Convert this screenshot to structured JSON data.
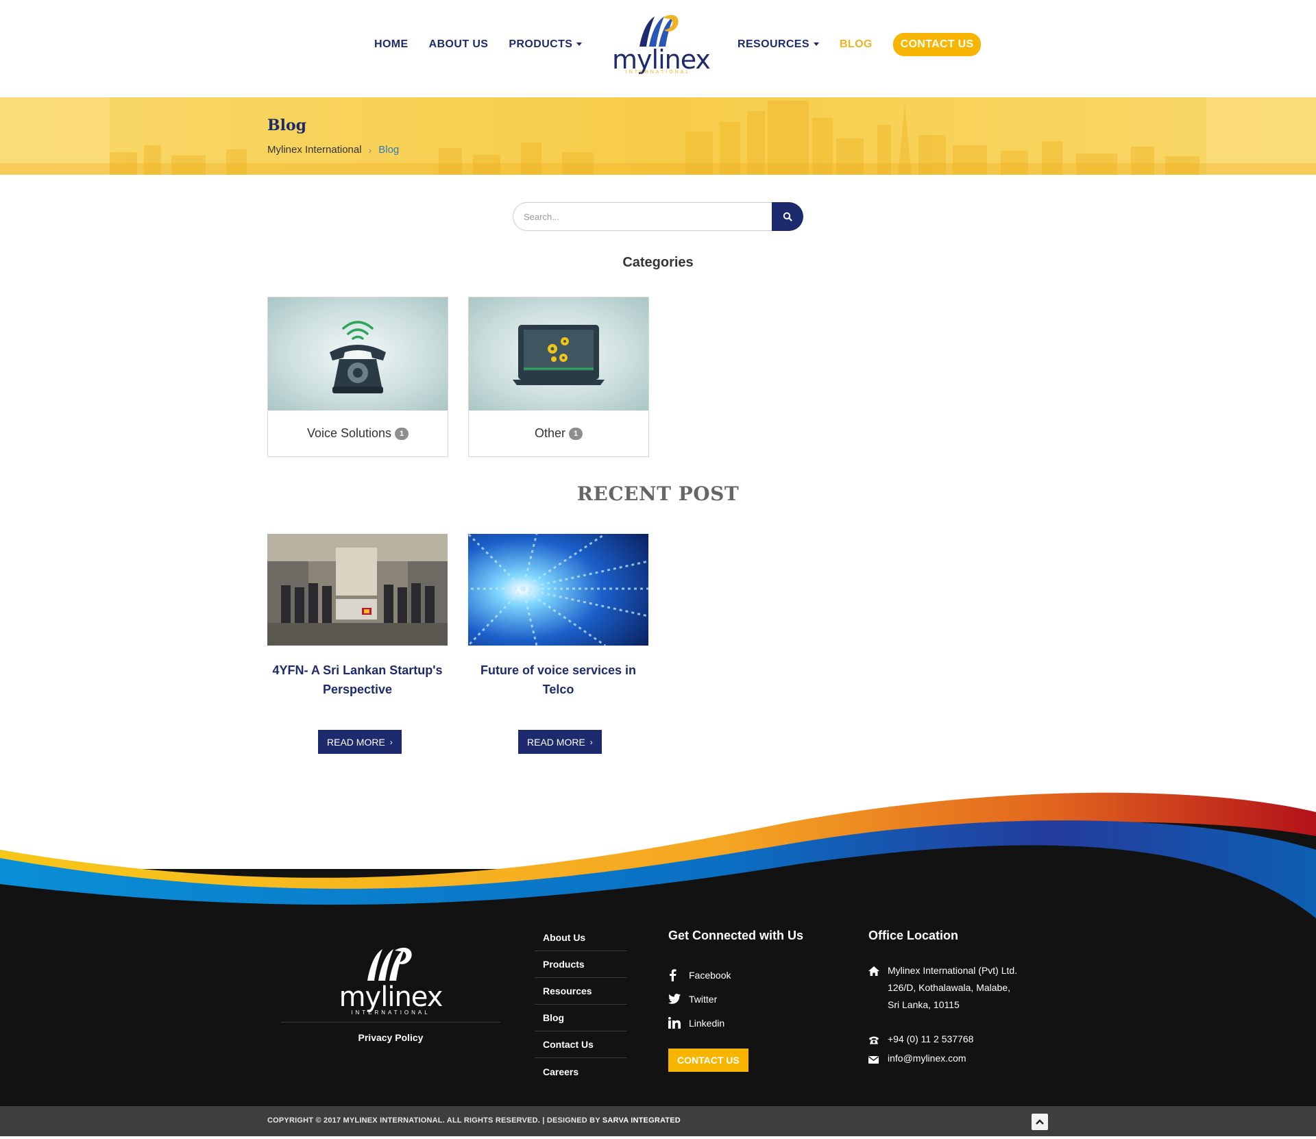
{
  "header": {
    "nav_left": [
      {
        "label": "HOME"
      },
      {
        "label": "ABOUT US"
      },
      {
        "label": "PRODUCTS",
        "dropdown": true
      }
    ],
    "nav_right": [
      {
        "label": "RESOURCES",
        "dropdown": true
      },
      {
        "label": "BLOG",
        "active": true
      }
    ],
    "cta": "CONTACT US",
    "logo": {
      "word": "mylinex",
      "sub": "INTERNATIONAL"
    }
  },
  "banner": {
    "title": "Blog",
    "breadcrumb": {
      "home": "Mylinex International",
      "separator": "›",
      "current": "Blog"
    }
  },
  "search": {
    "placeholder": "Search..."
  },
  "categories": {
    "title": "Categories",
    "items": [
      {
        "label": "Voice Solutions",
        "count": "1",
        "icon": "telephone-icon"
      },
      {
        "label": "Other",
        "count": "1",
        "icon": "laptop-gears-icon"
      }
    ]
  },
  "recent": {
    "title": "RECENT POST",
    "posts": [
      {
        "title": "4YFN- A Sri Lankan Startup's Perspective",
        "button": "READ MORE",
        "image": "group-photo"
      },
      {
        "title": "Future of voice services in Telco",
        "button": "READ MORE",
        "image": "digital-tunnel"
      }
    ]
  },
  "footer": {
    "logo": {
      "word": "mylinex",
      "sub": "INTERNATIONAL"
    },
    "privacy": "Privacy Policy",
    "links": [
      "About Us",
      "Products",
      "Resources",
      "Blog",
      "Contact Us",
      "Careers"
    ],
    "connect_heading": "Get Connected with Us",
    "social": [
      {
        "label": "Facebook",
        "icon": "facebook-icon"
      },
      {
        "label": "Twitter",
        "icon": "twitter-icon"
      },
      {
        "label": "Linkedin",
        "icon": "linkedin-icon"
      }
    ],
    "cta": "CONTACT US",
    "office_heading": "Office Location",
    "address": [
      "Mylinex International (Pvt) Ltd.",
      "126/D, Kothalawala, Malabe,",
      "Sri Lanka, 10115"
    ],
    "phone": "+94 (0) 11 2 537768",
    "email": "info@mylinex.com",
    "copyright": "COPYRIGHT © 2017 MYLINEX INTERNATIONAL. ALL RIGHTS RESERVED. | DESIGNED BY ",
    "designer": "SARVA INTEGRATED"
  },
  "colors": {
    "navy": "#1d2b6e",
    "accent": "#f7b500",
    "footer_bg": "#121212"
  }
}
